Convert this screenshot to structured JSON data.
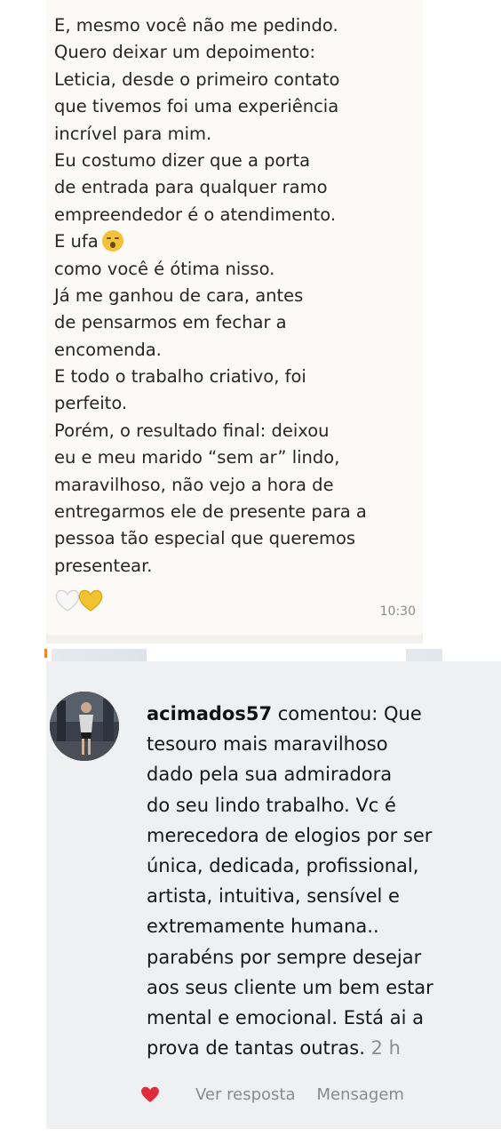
{
  "message": {
    "lines": [
      "E, mesmo você não me pedindo.",
      "Quero deixar um depoimento:",
      "Leticia, desde o primeiro contato",
      "que tivemos foi uma experiência",
      "incrível para mim.",
      "Eu costumo dizer que a porta",
      "de entrada para qualquer ramo",
      "empreendedor é o atendimento.",
      "E ufa",
      "como você é ótima nisso.",
      "Já me ganhou de cara, antes",
      "de pensarmos em fechar a",
      "encomenda.",
      "E todo o trabalho criativo, foi",
      "perfeito.",
      "Porém, o resultado final: deixou",
      "eu e meu marido “sem ar” lindo,",
      "maravilhoso, não vejo a hora de",
      "entregarmos ele de presente para a",
      "pessoa tão especial que queremos",
      "presentear."
    ],
    "emoji_after_line_9": "astonished-face-emoji",
    "hearts": [
      "white-heart-emoji",
      "yellow-heart-emoji"
    ],
    "time": "10:30"
  },
  "comment": {
    "username": "acimados57",
    "action_word": "comentou:",
    "first_line_text": "Que",
    "lines": [
      "tesouro mais maravilhoso",
      "dado pela sua  admiradora",
      "do seu lindo trabalho. Vc é",
      "merecedora de elogios por ser",
      "única, dedicada, profissional,",
      "artista, intuitiva, sensível e",
      "extremamente humana..",
      "parabéns por sempre desejar",
      "aos seus cliente um bem estar",
      "mental e emocional. Está ai a"
    ],
    "last_line": "prova de tantas outras.",
    "time_ago": "2 h",
    "actions": {
      "like_icon": "heart-icon",
      "reply_label": "Ver resposta",
      "message_label": "Mensagem"
    }
  },
  "colors": {
    "bubble": "#fbfaf7",
    "comment_bg": "#eff0f2",
    "heart_red": "#e02c3b",
    "timestamp_gray": "#8c8c8c"
  }
}
